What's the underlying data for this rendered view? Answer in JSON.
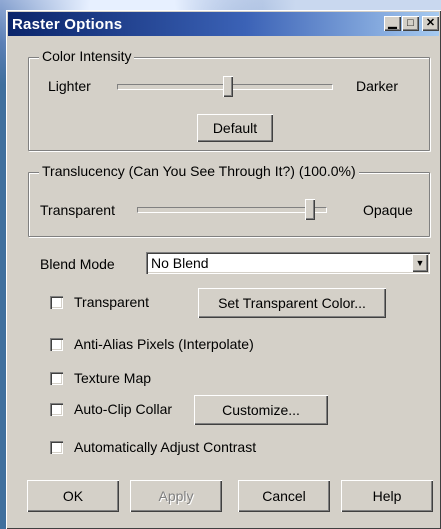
{
  "window": {
    "title": "Raster Options"
  },
  "color_intensity": {
    "label": "Color Intensity",
    "left_label": "Lighter",
    "right_label": "Darker",
    "value_fraction": 0.5,
    "default_label": "Default"
  },
  "translucency": {
    "label": "Translucency (Can You See Through It?) (100.0%)",
    "left_label": "Transparent",
    "right_label": "Opaque",
    "value_fraction": 1.0
  },
  "blend_mode": {
    "label": "Blend Mode",
    "selected": "No Blend"
  },
  "options": {
    "transparent": "Transparent",
    "set_transparent_color": "Set Transparent Color...",
    "anti_alias": "Anti-Alias Pixels (Interpolate)",
    "texture_map": "Texture Map",
    "auto_clip": "Auto-Clip Collar",
    "customize": "Customize...",
    "auto_contrast": "Automatically Adjust Contrast"
  },
  "footer": {
    "ok": "OK",
    "apply": "Apply",
    "cancel": "Cancel",
    "help": "Help"
  }
}
